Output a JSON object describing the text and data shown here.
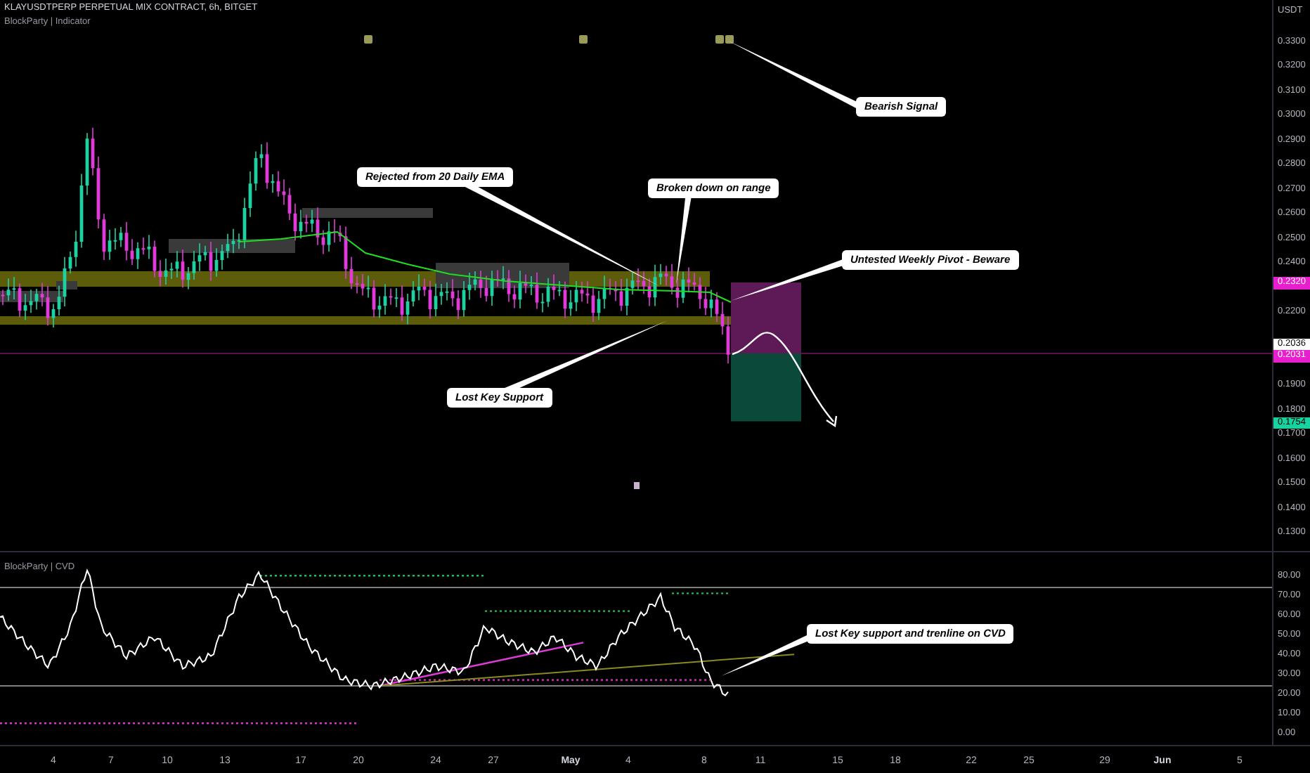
{
  "chart": {
    "symbol_title": "KLAYUSDTPERP PERPETUAL MIX CONTRACT, 6h, BITGET",
    "indicator_label": "BlockParty | Indicator",
    "currency": "USDT",
    "price_ticks": [
      "0.3300",
      "0.3200",
      "0.3100",
      "0.3000",
      "0.2900",
      "0.2800",
      "0.2700",
      "0.2600",
      "0.2500",
      "0.2400",
      "0.2200",
      "0.1900",
      "0.1800",
      "0.1700",
      "0.1600",
      "0.1500",
      "0.1400",
      "0.1300"
    ],
    "price_tags": [
      {
        "text": "0.2320",
        "kind": "entry"
      },
      {
        "text": "0.2036",
        "kind": "last"
      },
      {
        "text": "0.2031",
        "kind": "current"
      },
      {
        "text": "0.1754",
        "kind": "target"
      }
    ],
    "annotations": [
      "Bearish Signal",
      "Rejected from 20 Daily EMA",
      "Broken down on range",
      "Untested Weekly Pivot - Beware",
      "Lost Key Support"
    ]
  },
  "cvd_pane": {
    "title": "BlockParty | CVD",
    "ticks": [
      "80.00",
      "70.00",
      "60.00",
      "50.00",
      "40.00",
      "30.00",
      "20.00",
      "10.00",
      "0.00"
    ],
    "annotation": "Lost Key support and trenline on CVD"
  },
  "time_axis": {
    "labels": [
      {
        "text": "4",
        "kind": "day"
      },
      {
        "text": "7",
        "kind": "day"
      },
      {
        "text": "10",
        "kind": "day"
      },
      {
        "text": "13",
        "kind": "day"
      },
      {
        "text": "17",
        "kind": "day"
      },
      {
        "text": "20",
        "kind": "day"
      },
      {
        "text": "24",
        "kind": "day"
      },
      {
        "text": "27",
        "kind": "day"
      },
      {
        "text": "May",
        "kind": "month"
      },
      {
        "text": "4",
        "kind": "day"
      },
      {
        "text": "8",
        "kind": "day"
      },
      {
        "text": "11",
        "kind": "day"
      },
      {
        "text": "15",
        "kind": "day"
      },
      {
        "text": "18",
        "kind": "day"
      },
      {
        "text": "22",
        "kind": "day"
      },
      {
        "text": "25",
        "kind": "day"
      },
      {
        "text": "29",
        "kind": "day"
      },
      {
        "text": "Jun",
        "kind": "month"
      },
      {
        "text": "5",
        "kind": "day"
      }
    ]
  }
}
